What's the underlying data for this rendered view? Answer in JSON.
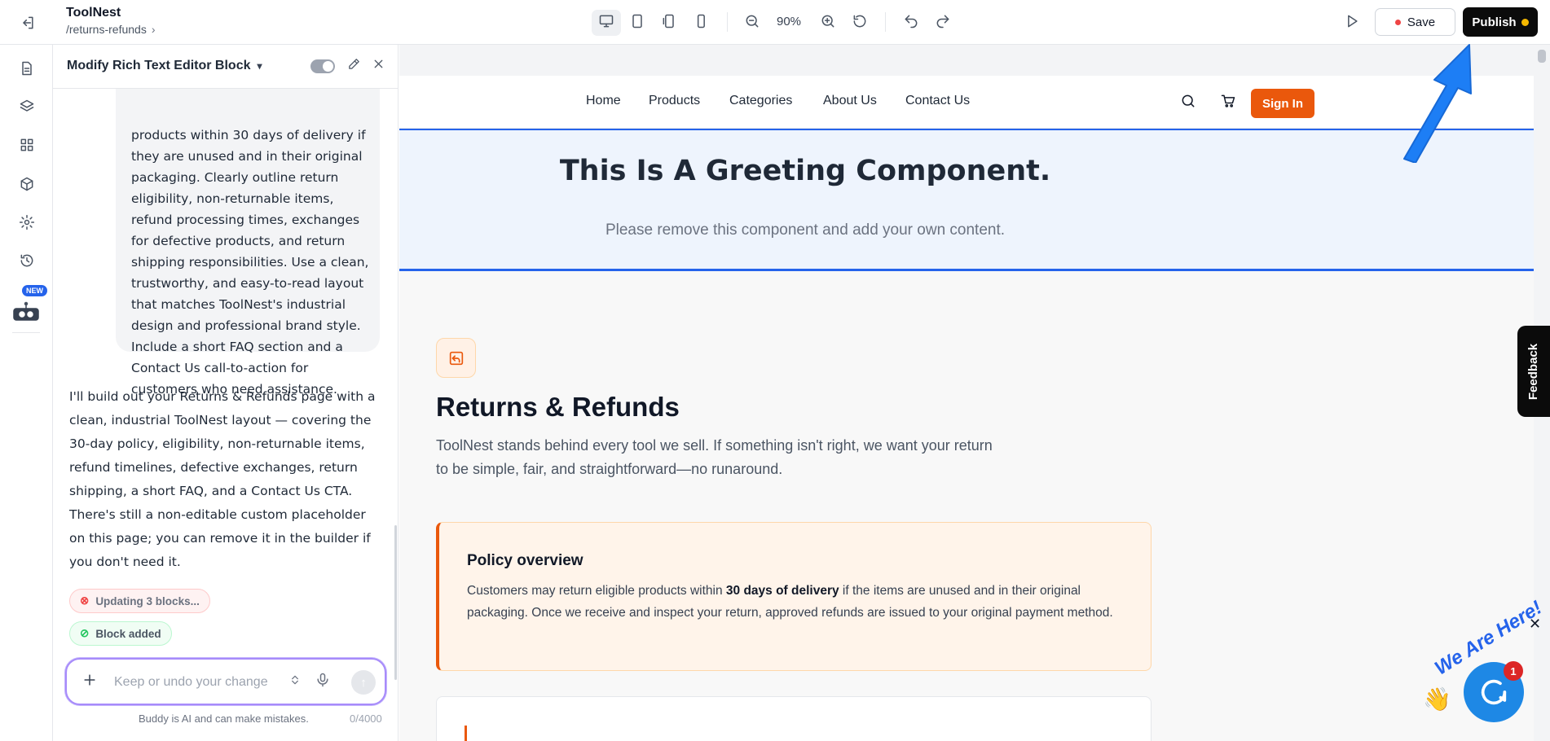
{
  "topbar": {
    "site_name": "ToolNest",
    "path": "/returns-refunds",
    "zoom": "90%",
    "save_label": "Save",
    "publish_label": "Publish"
  },
  "rail": {
    "new_badge": "NEW"
  },
  "panel": {
    "title": "Modify Rich Text Editor Block",
    "user_message": "products within 30 days of delivery if they are unused and in their original packaging. Clearly outline return eligibility, non-returnable items, refund processing times, exchanges for defective products, and return shipping responsibilities. Use a clean, trustworthy, and easy-to-read layout that matches ToolNest's industrial design and professional brand style. Include a short FAQ section and a Contact Us call-to-action for customers who need assistance.",
    "ai_message": "I'll build out your Returns & Refunds page with a clean, industrial ToolNest layout — covering the 30-day policy, eligibility, non-returnable items, refund timelines, defective exchanges, return shipping, a short FAQ, and a Contact Us CTA. There's still a non-editable custom placeholder on this page; you can remove it in the builder if you don't need it.",
    "status_updating": "Updating 3 blocks...",
    "status_added": "Block added",
    "input_placeholder": "Keep or undo your change",
    "disclaimer": "Buddy is AI and can make mistakes.",
    "char_counter": "0/4000"
  },
  "site": {
    "nav": [
      "Home",
      "Products",
      "Categories",
      "About Us",
      "Contact Us"
    ],
    "signin_label": "Sign In",
    "greeting_title": "This Is A Greeting Component.",
    "greeting_sub": "Please remove this component and add your own content.",
    "page_title": "Returns & Refunds",
    "page_sub": "ToolNest stands behind every tool we sell. If something isn't right, we want your return to be simple, fair, and straightforward—no runaround.",
    "policy_title": "Policy overview",
    "policy_text_before": "Customers may return eligible products within ",
    "policy_text_bold": "30 days of delivery",
    "policy_text_after": " if the items are unused and in their original packaging. Once we receive and inspect your return, approved refunds are issued to your original payment method."
  },
  "widgets": {
    "feedback_label": "Feedback",
    "chat_tagline": "We Are Here!",
    "chat_unread": "1",
    "close_glyph": "✕"
  },
  "colors": {
    "accent_orange": "#ea580c",
    "publish_bg": "#0b0b0b",
    "greeting_border": "#2563eb",
    "input_border": "#a78bfa"
  },
  "icons": [
    "exit-icon",
    "page-icon",
    "layers-icon",
    "grid-icon",
    "cube-icon",
    "gear-icon",
    "history-icon",
    "robot-icon",
    "desktop-icon",
    "tablet-icon",
    "tablet-landscape-icon",
    "phone-icon",
    "zoom-out-icon",
    "zoom-in-icon",
    "reset-icon",
    "undo-icon",
    "redo-icon",
    "play-icon",
    "search-icon",
    "cart-icon"
  ]
}
